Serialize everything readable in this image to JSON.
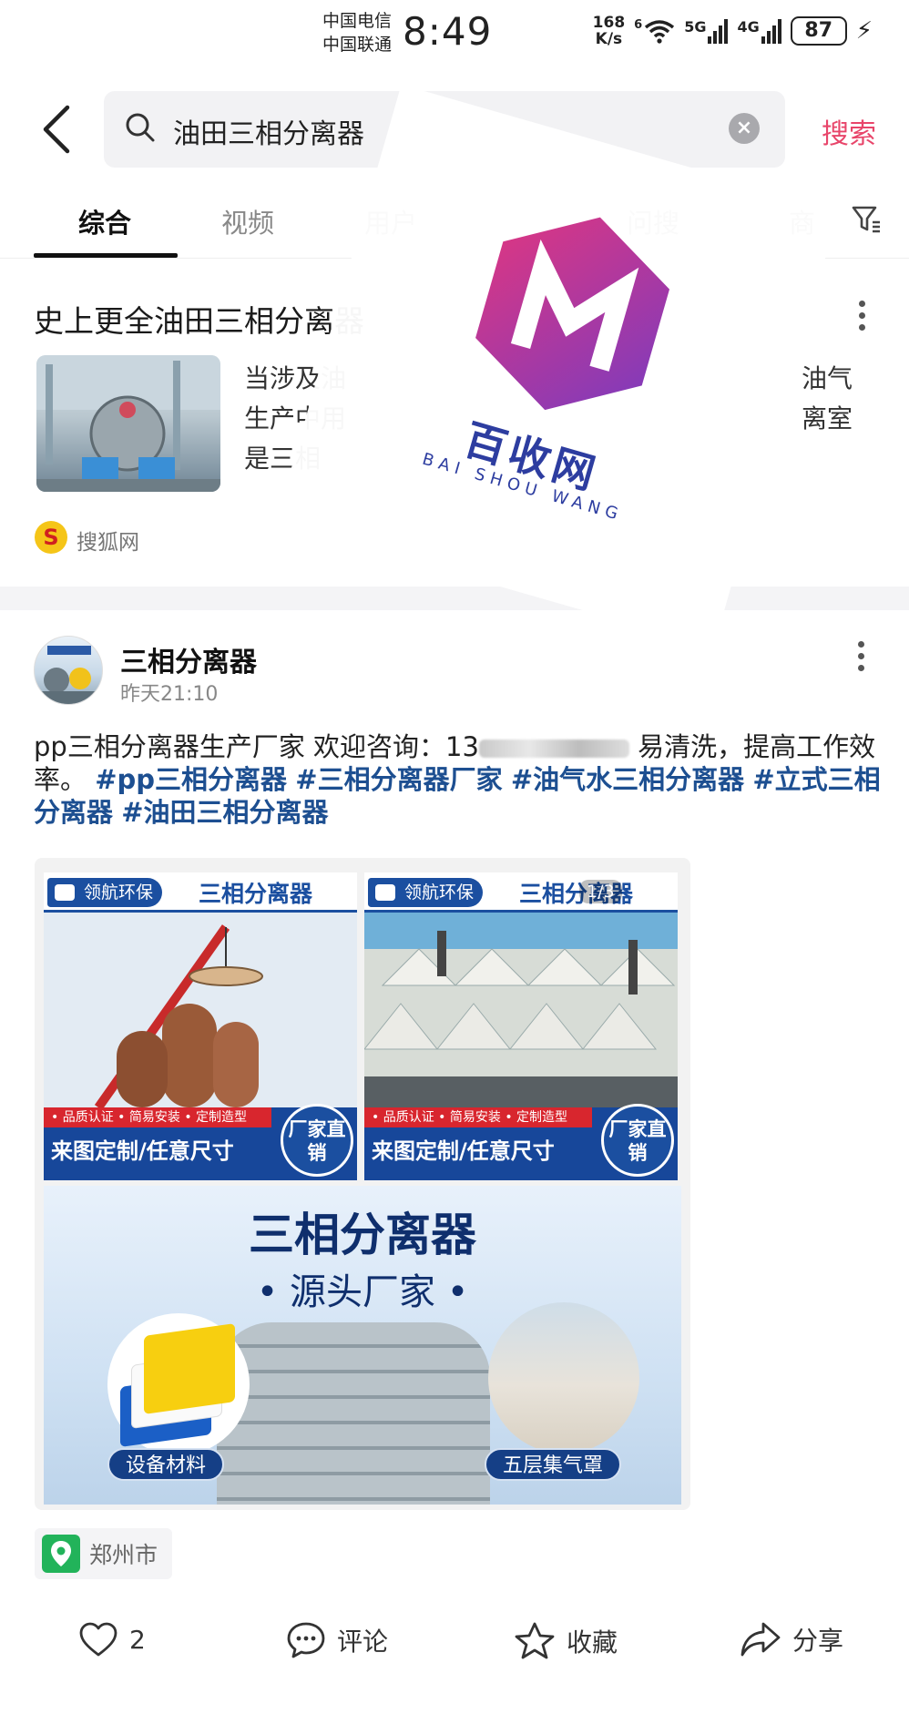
{
  "status_bar": {
    "carrier1": "中国电信",
    "carrier2": "中国联通",
    "time": "8:49",
    "net_speed_value": "168",
    "net_speed_unit": "K/s",
    "wifi_label": "6",
    "sig1_label": "5G",
    "sig2_label": "4G",
    "battery": "87"
  },
  "search": {
    "query": "油田三相分离器",
    "button": "搜索"
  },
  "tabs": [
    {
      "label": "综合",
      "active": true
    },
    {
      "label": "视频"
    },
    {
      "label": "用户"
    },
    {
      "label": "问搜"
    },
    {
      "label": "商"
    }
  ],
  "card1": {
    "title": "史上更全油田三相分离器",
    "text_left": [
      "当涉及油",
      "生产中用",
      "是三相"
    ],
    "text_right": [
      "油气",
      "离室"
    ],
    "source": "搜狐网"
  },
  "post": {
    "author": "三相分离器",
    "time": "昨天21:10",
    "text_start": "pp三相分离器生产厂家 欢迎咨询：13",
    "text_mid": "易清洗，提高工作效率。",
    "tags": [
      "#pp三相分离器",
      "#三相分离器厂家",
      "#油气水三相分离器",
      "#立式三相分离器",
      "#油田三相分离器"
    ],
    "images": {
      "brand": "领航环保",
      "title": "三相分离器",
      "strip": "• 品质认证 • 简易安装 • 定制造型",
      "foot": "来图定制/任意尺寸",
      "badge": "厂家直销",
      "page_indicator": "1/3",
      "banner_title": "三相分离器",
      "banner_sub": "• 源头厂家 •",
      "pill_left": "设备材料",
      "pill_right": "五层集气罩"
    },
    "location": "郑州市"
  },
  "actions": {
    "like_count": "2",
    "comment": "评论",
    "favorite": "收藏",
    "share": "分享"
  },
  "watermark": {
    "cn": "百收网",
    "en": "BAI SHOU WANG"
  },
  "colors": {
    "accent": "#e8456a",
    "hashtag": "#1d4f91",
    "brand_blue": "#1b4fa0",
    "logo_gradient_start": "#e2367f",
    "logo_gradient_end": "#7a3bbf"
  }
}
